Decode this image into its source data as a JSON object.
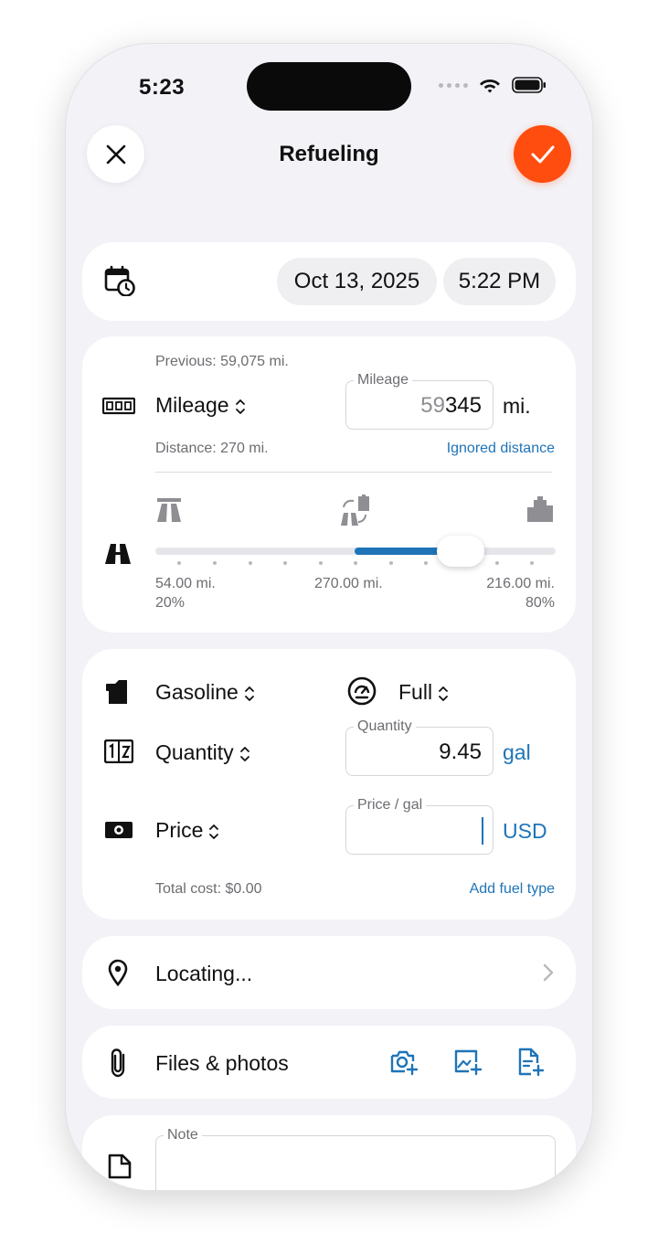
{
  "status_bar": {
    "time": "5:23"
  },
  "header": {
    "title": "Refueling"
  },
  "datetime": {
    "date": "Oct 13, 2025",
    "time": "5:22 PM"
  },
  "mileage": {
    "previous": "Previous: 59,075 mi.",
    "label": "Mileage",
    "field_label": "Mileage",
    "value_prefix": "59",
    "value_suffix": "345",
    "unit": "mi.",
    "distance": "Distance: 270 mi.",
    "ignored_link": "Ignored distance"
  },
  "driving_split": {
    "left_value": "54.00 mi.",
    "left_percent": "20%",
    "center_value": "270.00 mi.",
    "right_value": "216.00 mi.",
    "right_percent": "80%",
    "highway_fraction": 0.2,
    "accent": "#1f74b8"
  },
  "fuel": {
    "type_label": "Gasoline",
    "fill_label": "Full",
    "quantity_label": "Quantity",
    "quantity_field_label": "Quantity",
    "quantity_value": "9.45",
    "quantity_unit": "gal",
    "price_label": "Price",
    "price_field_label": "Price / gal",
    "price_value": "",
    "price_unit": "USD",
    "total_cost": "Total cost: $0.00",
    "add_fuel_type_link": "Add fuel type"
  },
  "location": {
    "label": "Locating..."
  },
  "files": {
    "label": "Files & photos"
  },
  "note": {
    "field_label": "Note",
    "value": ""
  },
  "colors": {
    "accent": "#1f74b8",
    "confirm": "#ff4d0f",
    "background": "#f2f2f7"
  }
}
